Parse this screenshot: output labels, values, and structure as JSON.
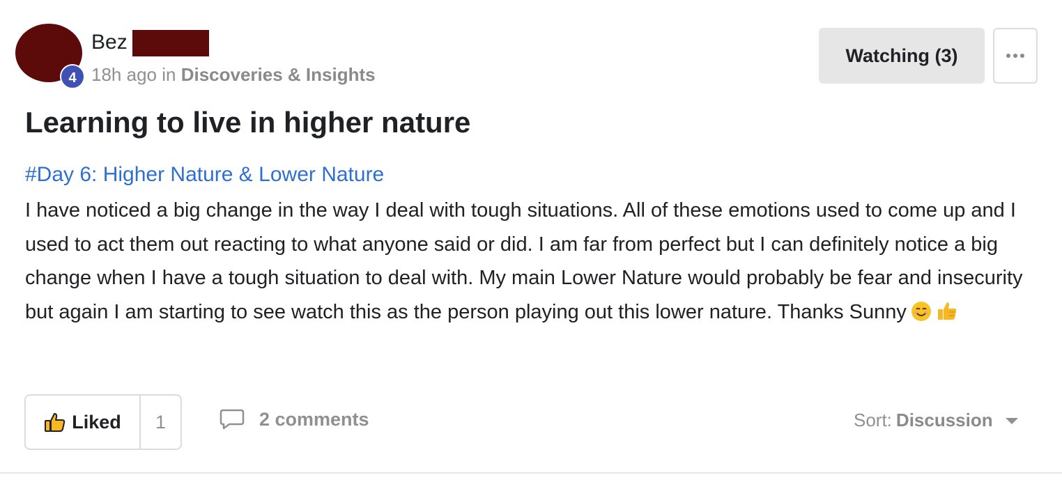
{
  "post": {
    "author": "Bez",
    "author_level": "4",
    "time_ago": "18h ago",
    "in_label": "in",
    "category": "Discoveries & Insights",
    "title": "Learning to live in higher nature",
    "hashtag": "#Day 6: Higher Nature & Lower Nature",
    "body": "I have noticed a big change in the way I deal with tough situations. All of these emotions used to come up and I used to act them out reacting to what anyone said or did. I am far from perfect but I can definitely notice a big change when I have a tough situation to deal with. My main Lower Nature would probably be fear and insecurity but again I am starting to see watch this as the person playing out this lower nature. Thanks Sunny"
  },
  "header_actions": {
    "watching_label": "Watching (3)",
    "more_icon": "ellipsis-icon"
  },
  "footer": {
    "like_label": "Liked",
    "like_count": "1",
    "comments_label": "2 comments",
    "sort_label": "Sort:",
    "sort_value": "Discussion"
  },
  "colors": {
    "accent_link": "#2f6fd0",
    "level_badge": "#3f51b5",
    "redaction": "#5c0a0a"
  }
}
